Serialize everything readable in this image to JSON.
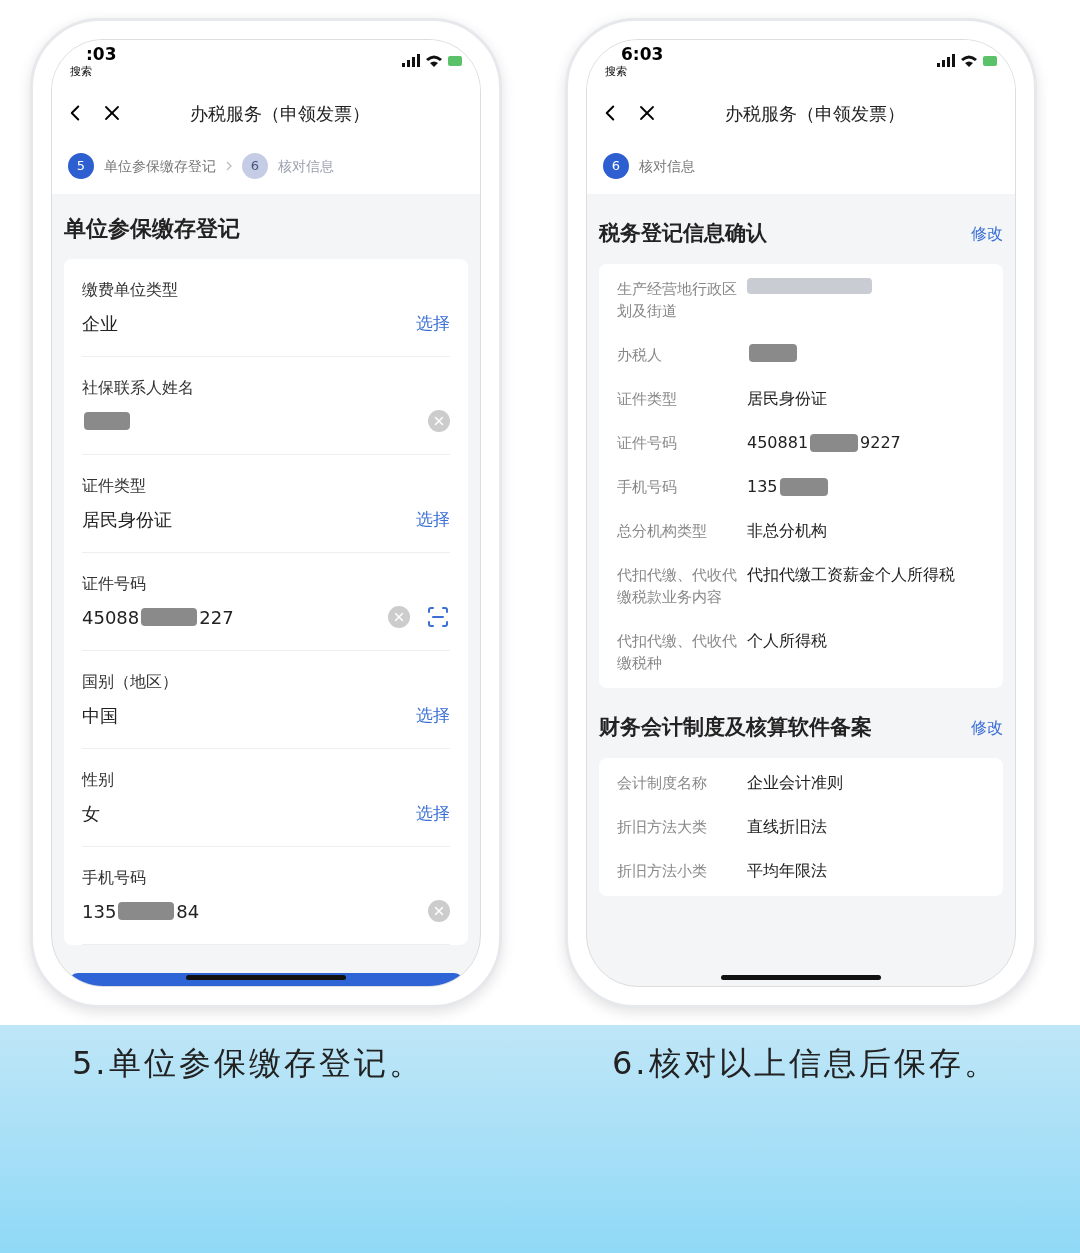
{
  "phones": [
    {
      "status_time": ":03",
      "back_label": "搜索",
      "title": "办税服务（申领发票）",
      "steps": [
        {
          "number": "5",
          "label": "单位参保缴存登记",
          "selected": true
        },
        {
          "number": "6",
          "label": "核对信息",
          "selected": false
        }
      ],
      "form": {
        "title": "单位参保缴存登记",
        "fields": [
          {
            "kind": "select",
            "label": "缴费单位类型",
            "value": "企业",
            "action": "选择"
          },
          {
            "kind": "clear",
            "label": "社保联系人姓名",
            "masked": true
          },
          {
            "kind": "select",
            "label": "证件类型",
            "value": "居民身份证",
            "action": "选择"
          },
          {
            "kind": "clear_scan",
            "label": "证件号码",
            "value": "45088",
            "value_end": "227",
            "masked": true
          },
          {
            "kind": "select",
            "label": "国别（地区）",
            "value": "中国",
            "action": "选择"
          },
          {
            "kind": "select",
            "label": "性别",
            "value": "女",
            "action": "选择"
          },
          {
            "kind": "clear",
            "label": "手机号码",
            "value": "135",
            "value_end": "84",
            "masked": true
          }
        ]
      }
    },
    {
      "status_time": "6:03",
      "back_label": "搜索",
      "title": "办税服务（申领发票）",
      "steps": [
        {
          "number": "6",
          "label": "核对信息",
          "selected": true
        }
      ],
      "sections": [
        {
          "title": "税务登记信息确认",
          "action": "修改",
          "rows": [
            {
              "label": "生产经营地行政区划及街道",
              "blurred": true
            },
            {
              "label": "办税人",
              "masked": true
            },
            {
              "label": "证件类型",
              "value": "居民身份证"
            },
            {
              "label": "证件号码",
              "value": "450881",
              "value_end": "9227",
              "masked": true
            },
            {
              "label": "手机号码",
              "value": "135",
              "masked": true
            },
            {
              "label": "总分机构类型",
              "value": "非总分机构"
            },
            {
              "label": "代扣代缴、代收代缴税款业务内容",
              "value": "代扣代缴工资薪金个人所得税"
            },
            {
              "label": "代扣代缴、代收代缴税种",
              "value": "个人所得税"
            }
          ]
        },
        {
          "title": "财务会计制度及核算软件备案",
          "action": "修改",
          "rows": [
            {
              "label": "会计制度名称",
              "value": "企业会计准则"
            },
            {
              "label": "折旧方法大类",
              "value": "直线折旧法"
            },
            {
              "label": "折旧方法小类",
              "value": "平均年限法"
            }
          ]
        }
      ]
    }
  ],
  "captions": [
    "5.单位参保缴存登记。",
    "6.核对以上信息后保存。"
  ]
}
